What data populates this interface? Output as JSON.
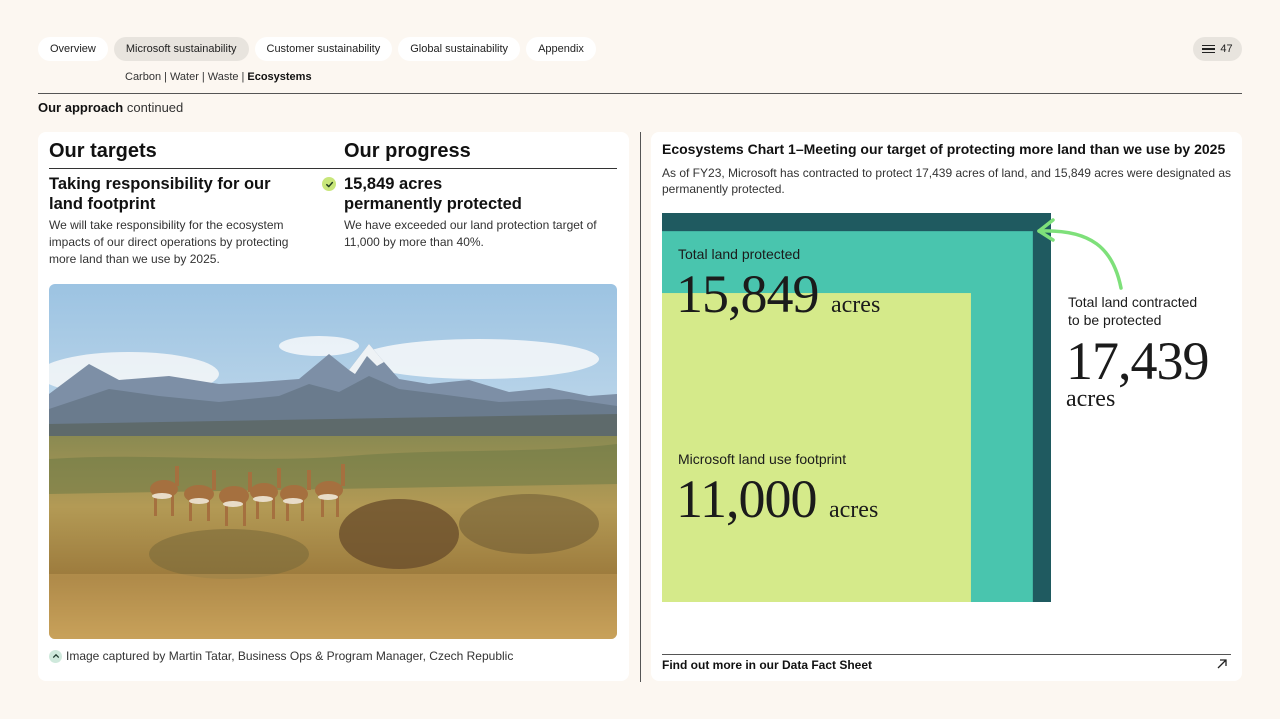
{
  "nav": {
    "tabs": [
      {
        "label": "Overview",
        "active": false
      },
      {
        "label": "Microsoft sustainability",
        "active": true
      },
      {
        "label": "Customer sustainability",
        "active": false
      },
      {
        "label": "Global sustainability",
        "active": false
      },
      {
        "label": "Appendix",
        "active": false
      }
    ],
    "page_number": "47",
    "menu_icon": "hamburger-menu-icon"
  },
  "subnav": {
    "items": [
      "Carbon",
      "Water",
      "Waste",
      "Ecosystems"
    ],
    "current": "Ecosystems"
  },
  "section": {
    "title_bold": "Our approach",
    "title_rest": "continued"
  },
  "left": {
    "targets_heading": "Our targets",
    "progress_heading": "Our progress",
    "target_title": "Taking responsibility for our land footprint",
    "target_text": "We will take responsibility for the ecosystem impacts of our direct operations by protecting more land than we use by 2025.",
    "progress_title_line1": "15,849 acres",
    "progress_title_line2": "permanently protected",
    "progress_text": "We have exceeded our land protection target of 11,000 by more than 40%.",
    "progress_status_icon": "check-icon",
    "caption": "Image captured by Martin Tatar, Business Ops & Program Manager, Czech Republic"
  },
  "right": {
    "chart_title": "Ecosystems Chart 1–Meeting our target of protecting more land than we use by 2025",
    "chart_subtitle": "As of FY23, Microsoft has contracted to protect 17,439 acres of land, and 15,849 acres were designated as permanently protected.",
    "footer_link": "Find out more in our Data Fact Sheet",
    "footer_icon": "external-link-arrow-icon"
  },
  "colors": {
    "background": "#fcf7f1",
    "contracted": "#1f5a60",
    "protected": "#49c5ae",
    "footprint": "#d5ea8a",
    "arrow": "#7ee07a"
  },
  "chart_data": {
    "type": "nested-square area",
    "title": "Ecosystems Chart 1–Meeting our target of protecting more land than we use by 2025",
    "unit": "acres",
    "series": [
      {
        "name": "Total land contracted to be protected",
        "value": 17439,
        "display": "17,439",
        "color": "#1f5a60"
      },
      {
        "name": "Total land protected",
        "value": 15849,
        "display": "15,849",
        "color": "#49c5ae"
      },
      {
        "name": "Microsoft land use footprint",
        "value": 11000,
        "display": "11,000",
        "color": "#d5ea8a"
      }
    ]
  }
}
